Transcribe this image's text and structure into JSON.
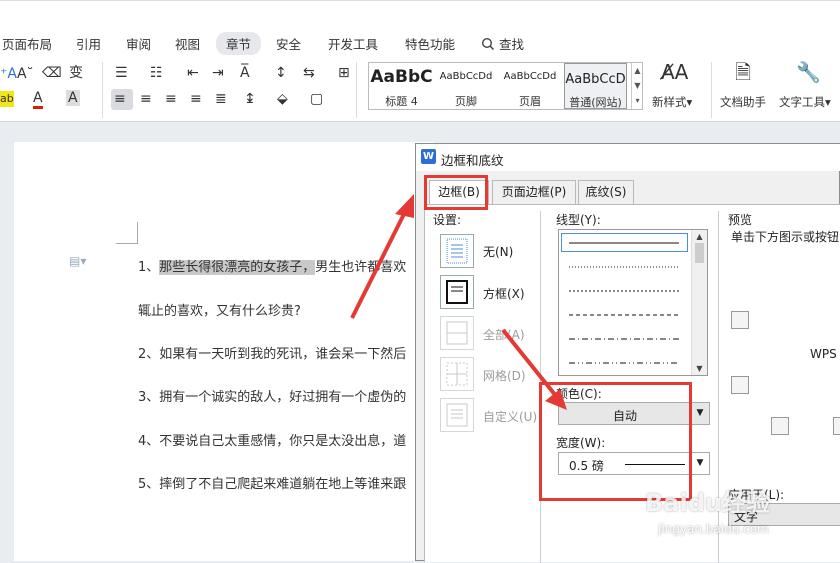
{
  "menubar": {
    "items": [
      "页面布局",
      "引用",
      "审阅",
      "视图",
      "章节",
      "安全",
      "开发工具",
      "特色功能"
    ],
    "active": "章节",
    "search_label": "查找"
  },
  "ribbon": {
    "styles": [
      {
        "sample": "AaBbC",
        "name": "标题 4"
      },
      {
        "sample": "AaBbCcDd",
        "name": "页脚"
      },
      {
        "sample": "AaBbCcDd",
        "name": "页眉"
      },
      {
        "sample": "AaBbCcD",
        "name": "普通(网站)"
      }
    ],
    "new_style_label": "新样式",
    "doc_helper_label": "文档助手",
    "text_tools_label": "文字工具"
  },
  "document": {
    "paragraphs": [
      {
        "highlight": "那些长得很漂亮的女孩子，",
        "prefix": "1、",
        "rest": "男生也许都喜欢"
      },
      {
        "text": "辄止的喜欢，又有什么珍贵?"
      },
      {
        "text": "2、如果有一天听到我的死讯，谁会呆一下然后"
      },
      {
        "text": "3、拥有一个诚实的敌人，好过拥有一个虚伪的"
      },
      {
        "text": "4、不要说自己太重感情，你只是太没出息，道"
      },
      {
        "text": "5、摔倒了不自己爬起来难道躺在地上等谁来跟"
      }
    ]
  },
  "dialog": {
    "title": "边框和底纹",
    "tabs": [
      "边框(B)",
      "页面边框(P)",
      "底纹(S)"
    ],
    "settings_label": "设置:",
    "settings": [
      {
        "label": "无(N)",
        "enabled": true
      },
      {
        "label": "方框(X)",
        "enabled": true
      },
      {
        "label": "全部(A)",
        "enabled": false
      },
      {
        "label": "网格(D)",
        "enabled": false
      },
      {
        "label": "自定义(U)",
        "enabled": false
      }
    ],
    "linestyle_label": "线型(Y):",
    "color_label": "颜色(C):",
    "color_value": "自动",
    "width_label": "宽度(W):",
    "width_value": "0.5  磅",
    "preview_label": "预览",
    "preview_hint": "单击下方图示或按钮",
    "preview_sample": "WPS",
    "apply_label": "应用于(L):",
    "apply_value": "文字"
  },
  "watermark": {
    "text": "Baidu经验",
    "url": "jingyan.baidu.com"
  },
  "colors": {
    "accent_red": "#e53935",
    "wps_blue": "#2b6fd6"
  }
}
